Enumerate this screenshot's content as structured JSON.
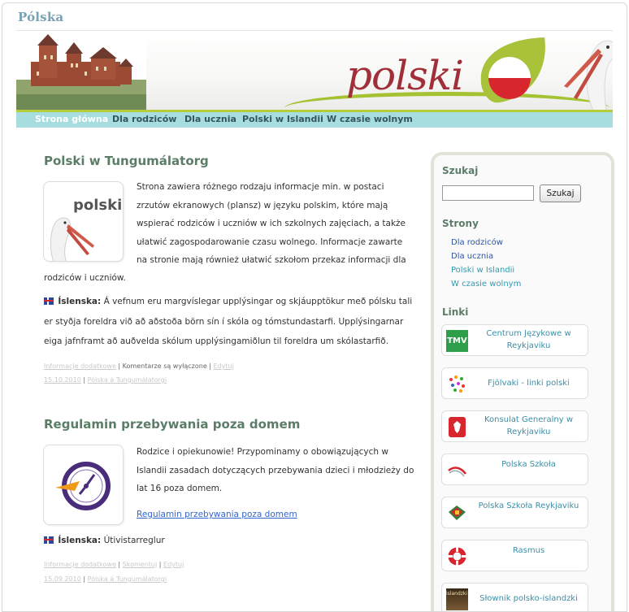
{
  "site": {
    "title": "Pólska",
    "logo_text": "polski"
  },
  "nav": [
    {
      "label": "Strona główna",
      "active": true
    },
    {
      "label": "Dla rodziców",
      "active": false
    },
    {
      "label": "Dla ucznia",
      "active": false
    },
    {
      "label": "Polski w Islandii",
      "active": false
    },
    {
      "label": "W czasie wolnym",
      "active": false
    }
  ],
  "posts": [
    {
      "title": "Polski w Tungumálatorg",
      "thumb_text": "polski",
      "lines": [
        "Strona zawiera różnego rodzaju informacje min. w postaci",
        "zrzutów ekranowych (plansz)  w języku polskim, które mają",
        "wspierać rodziców i uczniów w ich szkolnych zajęciach, a także",
        "ułatwić zagospodarowanie czasu wolnego. Informacje zawarte",
        "na stronie mają również ułatwić szkołom przekaz informacji dla",
        "rodziców i uczniów."
      ],
      "isl_label": "Íslenska:",
      "isl_lines": [
        "Á vefnum eru margvíslegar upplýsingar og skjáupptökur með pólsku tali",
        "er styðja foreldra við að aðstoða börn sín í skóla og tómstundastarfi. Upplýsingarnar",
        "eiga jafnframt að auðvelda skólum upplýsingamiðlun til foreldra um skólastarfið."
      ],
      "meta_link1": "Informacje dodatkowe",
      "meta_comments": "Komentarze są wyłączone",
      "meta_edit": "Edytuj",
      "meta_date": "15.10.2010",
      "meta_category": "Pólska á Tungumálatorgi"
    },
    {
      "title": "Regulamin przebywania poza domem",
      "lines": [
        "Rodzice i opiekunowie! Przypominamy o obowiązujących w",
        "Islandii zasadach dotyczących przebywania dzieci i młodzieży do",
        "lat 16 poza domem."
      ],
      "doc_link": "Regulamin przebywania poza domem",
      "isl_label": "Íslenska:",
      "isl_text": "Útivistarreglur",
      "meta_link1": "Informacje dodatkowe",
      "meta_comments": "Skomentuj",
      "meta_edit": "Edytuj",
      "meta_date": "15.09.2010",
      "meta_category": "Pólska á Tungumálatorgi"
    }
  ],
  "sidebar": {
    "search_heading": "Szukaj",
    "search_button": "Szukaj",
    "search_value": "",
    "pages_heading": "Strony",
    "pages": [
      "Dla rodziców",
      "Dla ucznia",
      "Polski w Islandii",
      "W czasie wolnym"
    ],
    "links_heading": "Linki",
    "links": [
      {
        "label": "Centrum Językowe w Reykjaviku",
        "icon": "tmv-logo-icon",
        "icon_text": "TMV"
      },
      {
        "label": "Fjölvaki - linki polski",
        "icon": "dots-logo-icon"
      },
      {
        "label": "Konsulat Generalny w Reykjaviku",
        "icon": "polish-eagle-icon"
      },
      {
        "label": "Polska Szkoła",
        "icon": "school-logo-icon"
      },
      {
        "label": "Polska Szkoła Reykjaviku",
        "icon": "books-icon"
      },
      {
        "label": "Rasmus",
        "icon": "lifebuoy-icon"
      },
      {
        "label": "Słownik polsko-islandzki",
        "icon": "dictionary-icon",
        "icon_text": "islandzki"
      }
    ]
  },
  "colors": {
    "nav_bg": "#a8dde0",
    "accent_green": "#b7cc3a",
    "title_green": "#5b7d68",
    "link_blue": "#3466cc",
    "logo_red": "#a02f3a"
  }
}
